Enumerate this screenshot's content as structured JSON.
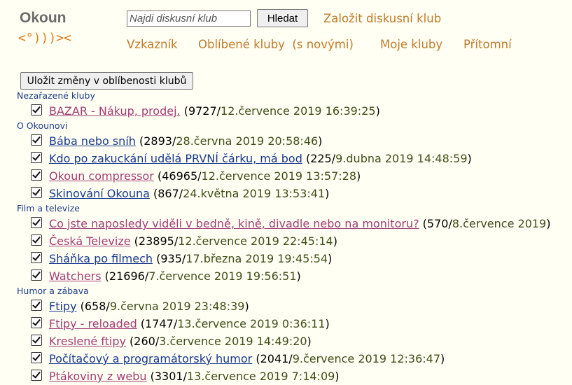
{
  "header": {
    "logo_text": "Okoun",
    "logo_fish": "<°)))><",
    "search_placeholder": "Najdi diskusní klub",
    "search_button": "Hledat",
    "create_club": "Založit diskusní klub",
    "nav": [
      "Vzkazník",
      "Oblíbené kluby  (s novými)",
      "Moje kluby",
      "Přítomní"
    ]
  },
  "save_button": "Uložit změny v oblíbenosti klubů",
  "colors": {
    "background": "#fffff3",
    "accent": "#c07a2a",
    "visited_link": "#a23c74",
    "link": "#18398e",
    "category": "#1d3b8a"
  },
  "categories": [
    {
      "name": "Nezařazené kluby",
      "clubs": [
        {
          "name": "BAZAR - Nákup, prodej.",
          "count": "9727",
          "date": "12.července 2019 16:39:25",
          "checked": true,
          "visited": true
        }
      ]
    },
    {
      "name": "O Okounovi",
      "clubs": [
        {
          "name": "Bába nebo sníh",
          "count": "2893",
          "date": "28.června 2019 20:58:46",
          "checked": true,
          "visited": false
        },
        {
          "name": "Kdo po zakuckání udělá PRVNÍ čárku, má bod",
          "count": "225",
          "date": "9.dubna 2019 14:48:59",
          "checked": true,
          "visited": false
        },
        {
          "name": "Okoun compressor",
          "count": "46965",
          "date": "12.července 2019 13:57:28",
          "checked": true,
          "visited": true
        },
        {
          "name": "Skinování Okouna",
          "count": "867",
          "date": "24.května 2019 13:53:41",
          "checked": true,
          "visited": false
        }
      ]
    },
    {
      "name": "Film a televize",
      "clubs": [
        {
          "name": "Co jste naposledy viděli v bedně, kině, divadle nebo na monitoru?",
          "count": "570",
          "date": "8.července 2019",
          "checked": true,
          "visited": true
        },
        {
          "name": "Česká Televize",
          "count": "23895",
          "date": "12.července 2019 22:45:14",
          "checked": true,
          "visited": true
        },
        {
          "name": "Sháňka po filmech",
          "count": "935",
          "date": "17.března 2019 19:45:54",
          "checked": true,
          "visited": false
        },
        {
          "name": "Watchers",
          "count": "21696",
          "date": "7.července 2019 19:56:51",
          "checked": true,
          "visited": true
        }
      ]
    },
    {
      "name": "Humor a zábava",
      "clubs": [
        {
          "name": "Ftipy",
          "count": "658",
          "date": "9.června 2019 23:48:39",
          "checked": true,
          "visited": false
        },
        {
          "name": "Ftipy - reloaded",
          "count": "1747",
          "date": "13.července 2019 0:36:11",
          "checked": true,
          "visited": true
        },
        {
          "name": "Kreslené ftipy",
          "count": "260",
          "date": "3.července 2019 14:49:20",
          "checked": true,
          "visited": true
        },
        {
          "name": "Počítačový a programátorský humor",
          "count": "2041",
          "date": "9.července 2019 12:36:47",
          "checked": true,
          "visited": false
        },
        {
          "name": "Ptákoviny z webu",
          "count": "3301",
          "date": "13.července 2019 7:14:09",
          "checked": true,
          "visited": true
        }
      ]
    }
  ]
}
